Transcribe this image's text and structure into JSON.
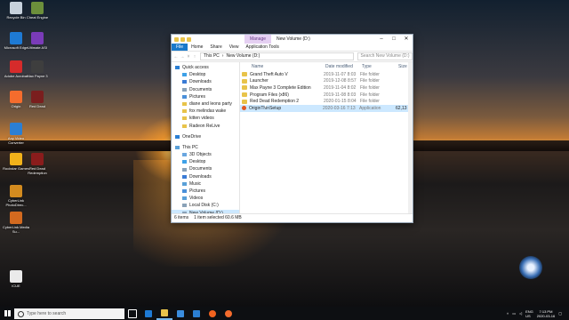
{
  "desktop_icons": [
    {
      "label": "Recycle Bin",
      "color": "#c7d2dc"
    },
    {
      "label": "Cheat Engine",
      "color": "#6c8f3b"
    },
    {
      "label": "Microsoft Edge",
      "color": "#1e7ad4"
    },
    {
      "label": "Ultimate ASI",
      "color": "#7a3bb8"
    },
    {
      "label": "Adobe Acrobat",
      "color": "#d62b2b"
    },
    {
      "label": "Max Payne 3",
      "color": "#3e3e3e"
    },
    {
      "label": "Origin",
      "color": "#f56c2d"
    },
    {
      "label": "Red Dead",
      "color": "#7a1e1e"
    },
    {
      "label": "Any Video Converter",
      "color": "#2b7fd3"
    },
    {
      "label": "Rockstar Games",
      "color": "#f2b21a"
    },
    {
      "label": "Red Dead Redemption",
      "color": "#8a1c1c"
    },
    {
      "label": "CyberLink PhotoDirec...",
      "color": "#d38b1f"
    },
    {
      "label": "CyberLink Media Su...",
      "color": "#d36a1f"
    },
    {
      "label": "iCUE",
      "color": "#eaeaea"
    }
  ],
  "window": {
    "contextual_tab": "Manage",
    "title": "New Volume (D:)",
    "ribbon_tabs": [
      "File",
      "Home",
      "Share",
      "View",
      "Application Tools"
    ],
    "path": [
      "This PC",
      "New Volume (D:)"
    ],
    "search_placeholder": "Search New Volume (D:)",
    "nav": [
      {
        "label": "Quick access",
        "indent": 0,
        "color": "#2b7fd3"
      },
      {
        "label": "Desktop",
        "indent": 1,
        "color": "#3ea1e8"
      },
      {
        "label": "Downloads",
        "indent": 1,
        "color": "#3a7bd5"
      },
      {
        "label": "Documents",
        "indent": 1,
        "color": "#8aa2b8"
      },
      {
        "label": "Pictures",
        "indent": 1,
        "color": "#4a90d9"
      },
      {
        "label": "diane and leons party",
        "indent": 1,
        "color": "#e8c34a"
      },
      {
        "label": "fox melindas wake",
        "indent": 1,
        "color": "#e8c34a"
      },
      {
        "label": "kitten videos",
        "indent": 1,
        "color": "#e8c34a"
      },
      {
        "label": "Radeon ReLive",
        "indent": 1,
        "color": "#e8c34a"
      },
      {
        "label": "OneDrive",
        "indent": 0,
        "color": "#2b7fd3"
      },
      {
        "label": "This PC",
        "indent": 0,
        "color": "#5aa0d8"
      },
      {
        "label": "3D Objects",
        "indent": 1,
        "color": "#6aa7e0"
      },
      {
        "label": "Desktop",
        "indent": 1,
        "color": "#3ea1e8"
      },
      {
        "label": "Documents",
        "indent": 1,
        "color": "#8aa2b8"
      },
      {
        "label": "Downloads",
        "indent": 1,
        "color": "#3a7bd5"
      },
      {
        "label": "Music",
        "indent": 1,
        "color": "#5aa0d8"
      },
      {
        "label": "Pictures",
        "indent": 1,
        "color": "#4a90d9"
      },
      {
        "label": "Videos",
        "indent": 1,
        "color": "#5aa0d8"
      },
      {
        "label": "Local Disk (C:)",
        "indent": 1,
        "color": "#8aa2b8"
      },
      {
        "label": "New Volume (D:)",
        "indent": 1,
        "color": "#8aa2b8",
        "selected": true
      }
    ],
    "columns": {
      "name": "Name",
      "date": "Date modified",
      "type": "Type",
      "size": "Size"
    },
    "files": [
      {
        "name": "Grand Theft Auto V",
        "date": "2019-11-07 8:03 PM",
        "type": "File folder",
        "size": "",
        "kind": "folder"
      },
      {
        "name": "Launcher",
        "date": "2019-12-08 8:57 PM",
        "type": "File folder",
        "size": "",
        "kind": "folder"
      },
      {
        "name": "Max Payne 3 Complete Edition",
        "date": "2019-11-04 8:02 PM",
        "type": "File folder",
        "size": "",
        "kind": "folder"
      },
      {
        "name": "Program Files (x86)",
        "date": "2019-11-08 8:03 PM",
        "type": "File folder",
        "size": "",
        "kind": "folder"
      },
      {
        "name": "Red Dead Redemption 2",
        "date": "2020-01-15 8:04 PM",
        "type": "File folder",
        "size": "",
        "kind": "folder"
      },
      {
        "name": "OriginThinSetup",
        "date": "2020-03-16 7:13 PM",
        "type": "Application",
        "size": "62,13",
        "kind": "app",
        "selected": true
      }
    ],
    "status": {
      "items": "6 items",
      "selected": "1 item selected  60.6 MB"
    }
  },
  "taskbar": {
    "search_placeholder": "Type here to search",
    "apps": [
      {
        "name": "task-view",
        "color": "#ffffff"
      },
      {
        "name": "edge",
        "color": "#1e7ad4"
      },
      {
        "name": "file-explorer",
        "color": "#e8c34a",
        "active": true
      },
      {
        "name": "store",
        "color": "#3a8dde"
      },
      {
        "name": "mail",
        "color": "#2b7fd3"
      },
      {
        "name": "firefox",
        "color": "#f2631f"
      },
      {
        "name": "origin",
        "color": "#f56c2d"
      }
    ],
    "tray": {
      "lang": "ENG\nUS",
      "time": "7:13 PM",
      "date": "2020-03-16"
    }
  },
  "colors": {
    "accent": "#1979ca",
    "selection": "#cce8ff"
  }
}
